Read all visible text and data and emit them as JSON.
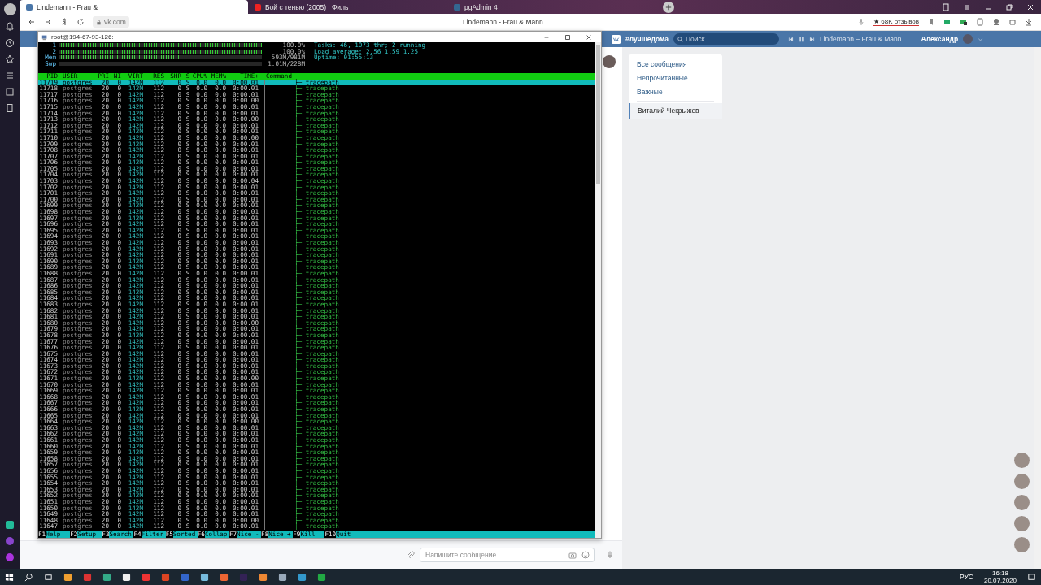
{
  "browser": {
    "tabs": [
      {
        "title": "Lindemann - Frau &",
        "selected": true
      },
      {
        "title": "Бой с тенью (2005) | Филь",
        "selected": false
      },
      {
        "title": "pgAdmin 4",
        "selected": false
      }
    ],
    "address": "vk.com",
    "page_title": "Lindemann - Frau & Mann",
    "reviews": "★ 68K отзывов"
  },
  "vk_header": {
    "hashtag": "#лучшедома",
    "search_placeholder": "Поиск",
    "track": "Lindemann – Frau & Mann",
    "user": "Александр"
  },
  "terminal": {
    "title": "root@194-67-93-126: ~",
    "meters": [
      {
        "label": "1",
        "level": 1.0,
        "reading": "100.0%"
      },
      {
        "label": "2",
        "level": 1.0,
        "reading": "100.0%"
      },
      {
        "label": "Mem",
        "level": 0.6,
        "reading": "593M/981M"
      },
      {
        "label": "Swp",
        "level": 0.01,
        "reading": "1.01M/228M"
      }
    ],
    "stats": [
      "Tasks: 46, 1073 thr; 2 running",
      "Load average: 2.56 1.59 1.25",
      "Uptime: 01:55:13"
    ],
    "columns": [
      "PID",
      "USER",
      "PRI",
      "NI",
      "VIRT",
      "RES",
      "SHR",
      "S",
      "CPU%",
      "MEM%",
      "TIME+",
      "Command"
    ],
    "rows": [
      {
        "cells": [
          "11719",
          "postgres",
          "20",
          "0",
          "142M",
          "112",
          "0",
          "S",
          "0.0",
          "0.0",
          "0:00.01",
          "├─ tracepath"
        ],
        "selected": true
      },
      {
        "cells": [
          "11718",
          "postgres",
          "20",
          "0",
          "142M",
          "112",
          "0",
          "S",
          "0.0",
          "0.0",
          "0:00.01",
          "├─ tracepath"
        ],
        "selected": false
      },
      {
        "cells": [
          "11717",
          "postgres",
          "20",
          "0",
          "142M",
          "112",
          "0",
          "S",
          "0.0",
          "0.0",
          "0:00.01",
          "├─ tracepath"
        ],
        "selected": false
      },
      {
        "cells": [
          "11716",
          "postgres",
          "20",
          "0",
          "142M",
          "112",
          "0",
          "S",
          "0.0",
          "0.0",
          "0:00.00",
          "├─ tracepath"
        ],
        "selected": false
      },
      {
        "cells": [
          "11715",
          "postgres",
          "20",
          "0",
          "142M",
          "112",
          "0",
          "S",
          "0.0",
          "0.0",
          "0:00.01",
          "├─ tracepath"
        ],
        "selected": false
      },
      {
        "cells": [
          "11714",
          "postgres",
          "20",
          "0",
          "142M",
          "112",
          "0",
          "S",
          "0.0",
          "0.0",
          "0:00.01",
          "├─ tracepath"
        ],
        "selected": false
      },
      {
        "cells": [
          "11713",
          "postgres",
          "20",
          "0",
          "142M",
          "112",
          "0",
          "S",
          "0.0",
          "0.0",
          "0:00.00",
          "├─ tracepath"
        ],
        "selected": false
      },
      {
        "cells": [
          "11712",
          "postgres",
          "20",
          "0",
          "142M",
          "112",
          "0",
          "S",
          "0.0",
          "0.0",
          "0:00.01",
          "├─ tracepath"
        ],
        "selected": false
      },
      {
        "cells": [
          "11711",
          "postgres",
          "20",
          "0",
          "142M",
          "112",
          "0",
          "S",
          "0.0",
          "0.0",
          "0:00.01",
          "├─ tracepath"
        ],
        "selected": false
      },
      {
        "cells": [
          "11710",
          "postgres",
          "20",
          "0",
          "142M",
          "112",
          "0",
          "S",
          "0.0",
          "0.0",
          "0:00.00",
          "├─ tracepath"
        ],
        "selected": false
      },
      {
        "cells": [
          "11709",
          "postgres",
          "20",
          "0",
          "142M",
          "112",
          "0",
          "S",
          "0.0",
          "0.0",
          "0:00.01",
          "├─ tracepath"
        ],
        "selected": false
      },
      {
        "cells": [
          "11708",
          "postgres",
          "20",
          "0",
          "142M",
          "112",
          "0",
          "S",
          "0.0",
          "0.0",
          "0:00.01",
          "├─ tracepath"
        ],
        "selected": false
      },
      {
        "cells": [
          "11707",
          "postgres",
          "20",
          "0",
          "142M",
          "112",
          "0",
          "S",
          "0.0",
          "0.0",
          "0:00.01",
          "├─ tracepath"
        ],
        "selected": false
      },
      {
        "cells": [
          "11706",
          "postgres",
          "20",
          "0",
          "142M",
          "112",
          "0",
          "S",
          "0.0",
          "0.0",
          "0:00.01",
          "├─ tracepath"
        ],
        "selected": false
      },
      {
        "cells": [
          "11705",
          "postgres",
          "20",
          "0",
          "142M",
          "112",
          "0",
          "S",
          "0.0",
          "0.0",
          "0:00.01",
          "├─ tracepath"
        ],
        "selected": false
      },
      {
        "cells": [
          "11704",
          "postgres",
          "20",
          "0",
          "142M",
          "112",
          "0",
          "S",
          "0.0",
          "0.0",
          "0:00.01",
          "├─ tracepath"
        ],
        "selected": false
      },
      {
        "cells": [
          "11703",
          "postgres",
          "20",
          "0",
          "142M",
          "112",
          "0",
          "S",
          "0.0",
          "0.0",
          "0:00.04",
          "├─ tracepath"
        ],
        "selected": false
      },
      {
        "cells": [
          "11702",
          "postgres",
          "20",
          "0",
          "142M",
          "112",
          "0",
          "S",
          "0.0",
          "0.0",
          "0:00.01",
          "├─ tracepath"
        ],
        "selected": false
      },
      {
        "cells": [
          "11701",
          "postgres",
          "20",
          "0",
          "142M",
          "112",
          "0",
          "S",
          "0.0",
          "0.0",
          "0:00.01",
          "├─ tracepath"
        ],
        "selected": false
      },
      {
        "cells": [
          "11700",
          "postgres",
          "20",
          "0",
          "142M",
          "112",
          "0",
          "S",
          "0.0",
          "0.0",
          "0:00.01",
          "├─ tracepath"
        ],
        "selected": false
      },
      {
        "cells": [
          "11699",
          "postgres",
          "20",
          "0",
          "142M",
          "112",
          "0",
          "S",
          "0.0",
          "0.0",
          "0:00.01",
          "├─ tracepath"
        ],
        "selected": false
      },
      {
        "cells": [
          "11698",
          "postgres",
          "20",
          "0",
          "142M",
          "112",
          "0",
          "S",
          "0.0",
          "0.0",
          "0:00.01",
          "├─ tracepath"
        ],
        "selected": false
      },
      {
        "cells": [
          "11697",
          "postgres",
          "20",
          "0",
          "142M",
          "112",
          "0",
          "S",
          "0.0",
          "0.0",
          "0:00.01",
          "├─ tracepath"
        ],
        "selected": false
      },
      {
        "cells": [
          "11696",
          "postgres",
          "20",
          "0",
          "142M",
          "112",
          "0",
          "S",
          "0.0",
          "0.0",
          "0:00.01",
          "├─ tracepath"
        ],
        "selected": false
      },
      {
        "cells": [
          "11695",
          "postgres",
          "20",
          "0",
          "142M",
          "112",
          "0",
          "S",
          "0.0",
          "0.0",
          "0:00.01",
          "├─ tracepath"
        ],
        "selected": false
      },
      {
        "cells": [
          "11694",
          "postgres",
          "20",
          "0",
          "142M",
          "112",
          "0",
          "S",
          "0.0",
          "0.0",
          "0:00.01",
          "├─ tracepath"
        ],
        "selected": false
      },
      {
        "cells": [
          "11693",
          "postgres",
          "20",
          "0",
          "142M",
          "112",
          "0",
          "S",
          "0.0",
          "0.0",
          "0:00.01",
          "├─ tracepath"
        ],
        "selected": false
      },
      {
        "cells": [
          "11692",
          "postgres",
          "20",
          "0",
          "142M",
          "112",
          "0",
          "S",
          "0.0",
          "0.0",
          "0:00.01",
          "├─ tracepath"
        ],
        "selected": false
      },
      {
        "cells": [
          "11691",
          "postgres",
          "20",
          "0",
          "142M",
          "112",
          "0",
          "S",
          "0.0",
          "0.0",
          "0:00.01",
          "├─ tracepath"
        ],
        "selected": false
      },
      {
        "cells": [
          "11690",
          "postgres",
          "20",
          "0",
          "142M",
          "112",
          "0",
          "S",
          "0.0",
          "0.0",
          "0:00.01",
          "├─ tracepath"
        ],
        "selected": false
      },
      {
        "cells": [
          "11689",
          "postgres",
          "20",
          "0",
          "142M",
          "112",
          "0",
          "S",
          "0.0",
          "0.0",
          "0:00.01",
          "├─ tracepath"
        ],
        "selected": false
      },
      {
        "cells": [
          "11688",
          "postgres",
          "20",
          "0",
          "142M",
          "112",
          "0",
          "S",
          "0.0",
          "0.0",
          "0:00.01",
          "├─ tracepath"
        ],
        "selected": false
      },
      {
        "cells": [
          "11687",
          "postgres",
          "20",
          "0",
          "142M",
          "112",
          "0",
          "S",
          "0.0",
          "0.0",
          "0:00.01",
          "├─ tracepath"
        ],
        "selected": false
      },
      {
        "cells": [
          "11686",
          "postgres",
          "20",
          "0",
          "142M",
          "112",
          "0",
          "S",
          "0.0",
          "0.0",
          "0:00.01",
          "├─ tracepath"
        ],
        "selected": false
      },
      {
        "cells": [
          "11685",
          "postgres",
          "20",
          "0",
          "142M",
          "112",
          "0",
          "S",
          "0.0",
          "0.0",
          "0:00.01",
          "├─ tracepath"
        ],
        "selected": false
      },
      {
        "cells": [
          "11684",
          "postgres",
          "20",
          "0",
          "142M",
          "112",
          "0",
          "S",
          "0.0",
          "0.0",
          "0:00.01",
          "├─ tracepath"
        ],
        "selected": false
      },
      {
        "cells": [
          "11683",
          "postgres",
          "20",
          "0",
          "142M",
          "112",
          "0",
          "S",
          "0.0",
          "0.0",
          "0:00.01",
          "├─ tracepath"
        ],
        "selected": false
      },
      {
        "cells": [
          "11682",
          "postgres",
          "20",
          "0",
          "142M",
          "112",
          "0",
          "S",
          "0.0",
          "0.0",
          "0:00.01",
          "├─ tracepath"
        ],
        "selected": false
      },
      {
        "cells": [
          "11681",
          "postgres",
          "20",
          "0",
          "142M",
          "112",
          "0",
          "S",
          "0.0",
          "0.0",
          "0:00.01",
          "├─ tracepath"
        ],
        "selected": false
      },
      {
        "cells": [
          "11680",
          "postgres",
          "20",
          "0",
          "142M",
          "112",
          "0",
          "S",
          "0.0",
          "0.0",
          "0:00.00",
          "├─ tracepath"
        ],
        "selected": false
      },
      {
        "cells": [
          "11679",
          "postgres",
          "20",
          "0",
          "142M",
          "112",
          "0",
          "S",
          "0.0",
          "0.0",
          "0:00.01",
          "├─ tracepath"
        ],
        "selected": false
      },
      {
        "cells": [
          "11678",
          "postgres",
          "20",
          "0",
          "142M",
          "112",
          "0",
          "S",
          "0.0",
          "0.0",
          "0:00.01",
          "├─ tracepath"
        ],
        "selected": false
      },
      {
        "cells": [
          "11677",
          "postgres",
          "20",
          "0",
          "142M",
          "112",
          "0",
          "S",
          "0.0",
          "0.0",
          "0:00.01",
          "├─ tracepath"
        ],
        "selected": false
      },
      {
        "cells": [
          "11676",
          "postgres",
          "20",
          "0",
          "142M",
          "112",
          "0",
          "S",
          "0.0",
          "0.0",
          "0:00.01",
          "├─ tracepath"
        ],
        "selected": false
      },
      {
        "cells": [
          "11675",
          "postgres",
          "20",
          "0",
          "142M",
          "112",
          "0",
          "S",
          "0.0",
          "0.0",
          "0:00.01",
          "├─ tracepath"
        ],
        "selected": false
      },
      {
        "cells": [
          "11674",
          "postgres",
          "20",
          "0",
          "142M",
          "112",
          "0",
          "S",
          "0.0",
          "0.0",
          "0:00.01",
          "├─ tracepath"
        ],
        "selected": false
      },
      {
        "cells": [
          "11673",
          "postgres",
          "20",
          "0",
          "142M",
          "112",
          "0",
          "S",
          "0.0",
          "0.0",
          "0:00.01",
          "├─ tracepath"
        ],
        "selected": false
      },
      {
        "cells": [
          "11672",
          "postgres",
          "20",
          "0",
          "142M",
          "112",
          "0",
          "S",
          "0.0",
          "0.0",
          "0:00.01",
          "├─ tracepath"
        ],
        "selected": false
      },
      {
        "cells": [
          "11671",
          "postgres",
          "20",
          "0",
          "142M",
          "112",
          "0",
          "S",
          "0.0",
          "0.0",
          "0:00.00",
          "├─ tracepath"
        ],
        "selected": false
      },
      {
        "cells": [
          "11670",
          "postgres",
          "20",
          "0",
          "142M",
          "112",
          "0",
          "S",
          "0.0",
          "0.0",
          "0:00.01",
          "├─ tracepath"
        ],
        "selected": false
      },
      {
        "cells": [
          "11669",
          "postgres",
          "20",
          "0",
          "142M",
          "112",
          "0",
          "S",
          "0.0",
          "0.0",
          "0:00.01",
          "├─ tracepath"
        ],
        "selected": false
      },
      {
        "cells": [
          "11668",
          "postgres",
          "20",
          "0",
          "142M",
          "112",
          "0",
          "S",
          "0.0",
          "0.0",
          "0:00.01",
          "├─ tracepath"
        ],
        "selected": false
      },
      {
        "cells": [
          "11667",
          "postgres",
          "20",
          "0",
          "142M",
          "112",
          "0",
          "S",
          "0.0",
          "0.0",
          "0:00.01",
          "├─ tracepath"
        ],
        "selected": false
      },
      {
        "cells": [
          "11666",
          "postgres",
          "20",
          "0",
          "142M",
          "112",
          "0",
          "S",
          "0.0",
          "0.0",
          "0:00.01",
          "├─ tracepath"
        ],
        "selected": false
      },
      {
        "cells": [
          "11665",
          "postgres",
          "20",
          "0",
          "142M",
          "112",
          "0",
          "S",
          "0.0",
          "0.0",
          "0:00.01",
          "├─ tracepath"
        ],
        "selected": false
      },
      {
        "cells": [
          "11664",
          "postgres",
          "20",
          "0",
          "142M",
          "112",
          "0",
          "S",
          "0.0",
          "0.0",
          "0:00.00",
          "├─ tracepath"
        ],
        "selected": false
      },
      {
        "cells": [
          "11663",
          "postgres",
          "20",
          "0",
          "142M",
          "112",
          "0",
          "S",
          "0.0",
          "0.0",
          "0:00.01",
          "├─ tracepath"
        ],
        "selected": false
      },
      {
        "cells": [
          "11662",
          "postgres",
          "20",
          "0",
          "142M",
          "112",
          "0",
          "S",
          "0.0",
          "0.0",
          "0:00.01",
          "├─ tracepath"
        ],
        "selected": false
      },
      {
        "cells": [
          "11661",
          "postgres",
          "20",
          "0",
          "142M",
          "112",
          "0",
          "S",
          "0.0",
          "0.0",
          "0:00.01",
          "├─ tracepath"
        ],
        "selected": false
      },
      {
        "cells": [
          "11660",
          "postgres",
          "20",
          "0",
          "142M",
          "112",
          "0",
          "S",
          "0.0",
          "0.0",
          "0:00.01",
          "├─ tracepath"
        ],
        "selected": false
      },
      {
        "cells": [
          "11659",
          "postgres",
          "20",
          "0",
          "142M",
          "112",
          "0",
          "S",
          "0.0",
          "0.0",
          "0:00.01",
          "├─ tracepath"
        ],
        "selected": false
      },
      {
        "cells": [
          "11658",
          "postgres",
          "20",
          "0",
          "142M",
          "112",
          "0",
          "S",
          "0.0",
          "0.0",
          "0:00.01",
          "├─ tracepath"
        ],
        "selected": false
      },
      {
        "cells": [
          "11657",
          "postgres",
          "20",
          "0",
          "142M",
          "112",
          "0",
          "S",
          "0.0",
          "0.0",
          "0:00.01",
          "├─ tracepath"
        ],
        "selected": false
      },
      {
        "cells": [
          "11656",
          "postgres",
          "20",
          "0",
          "142M",
          "112",
          "0",
          "S",
          "0.0",
          "0.0",
          "0:00.01",
          "├─ tracepath"
        ],
        "selected": false
      },
      {
        "cells": [
          "11655",
          "postgres",
          "20",
          "0",
          "142M",
          "112",
          "0",
          "S",
          "0.0",
          "0.0",
          "0:00.01",
          "├─ tracepath"
        ],
        "selected": false
      },
      {
        "cells": [
          "11654",
          "postgres",
          "20",
          "0",
          "142M",
          "112",
          "0",
          "S",
          "0.0",
          "0.0",
          "0:00.01",
          "├─ tracepath"
        ],
        "selected": false
      },
      {
        "cells": [
          "11653",
          "postgres",
          "20",
          "0",
          "142M",
          "112",
          "0",
          "S",
          "0.0",
          "0.0",
          "0:00.01",
          "├─ tracepath"
        ],
        "selected": false
      },
      {
        "cells": [
          "11652",
          "postgres",
          "20",
          "0",
          "142M",
          "112",
          "0",
          "S",
          "0.0",
          "0.0",
          "0:00.01",
          "├─ tracepath"
        ],
        "selected": false
      },
      {
        "cells": [
          "11651",
          "postgres",
          "20",
          "0",
          "142M",
          "112",
          "0",
          "S",
          "0.0",
          "0.0",
          "0:00.01",
          "├─ tracepath"
        ],
        "selected": false
      },
      {
        "cells": [
          "11650",
          "postgres",
          "20",
          "0",
          "142M",
          "112",
          "0",
          "S",
          "0.0",
          "0.0",
          "0:00.01",
          "├─ tracepath"
        ],
        "selected": false
      },
      {
        "cells": [
          "11649",
          "postgres",
          "20",
          "0",
          "142M",
          "112",
          "0",
          "S",
          "0.0",
          "0.0",
          "0:00.01",
          "├─ tracepath"
        ],
        "selected": false
      },
      {
        "cells": [
          "11648",
          "postgres",
          "20",
          "0",
          "142M",
          "112",
          "0",
          "S",
          "0.0",
          "0.0",
          "0:00.00",
          "├─ tracepath"
        ],
        "selected": false
      },
      {
        "cells": [
          "11647",
          "postgres",
          "20",
          "0",
          "142M",
          "112",
          "0",
          "S",
          "0.0",
          "0.0",
          "0:00.01",
          "├─ tracepath"
        ],
        "selected": false
      }
    ],
    "function_keys": [
      {
        "key": "F1",
        "label": "Help"
      },
      {
        "key": "F2",
        "label": "Setup"
      },
      {
        "key": "F3",
        "label": "Search"
      },
      {
        "key": "F4",
        "label": "Filter"
      },
      {
        "key": "F5",
        "label": "Sorted"
      },
      {
        "key": "F6",
        "label": "Collap"
      },
      {
        "key": "F7",
        "label": "Nice -"
      },
      {
        "key": "F8",
        "label": "Nice +"
      },
      {
        "key": "F9",
        "label": "Kill"
      },
      {
        "key": "F10",
        "label": "Quit"
      }
    ]
  },
  "messages_menu": {
    "items": [
      "Все сообщения",
      "Непрочитанные",
      "Важные"
    ],
    "contact": "Виталий Чекрыжев"
  },
  "composer": {
    "placeholder": "Напишите сообщение..."
  },
  "taskbar": {
    "language": "РУС",
    "time": "16:18",
    "date": "20.07.2020"
  }
}
